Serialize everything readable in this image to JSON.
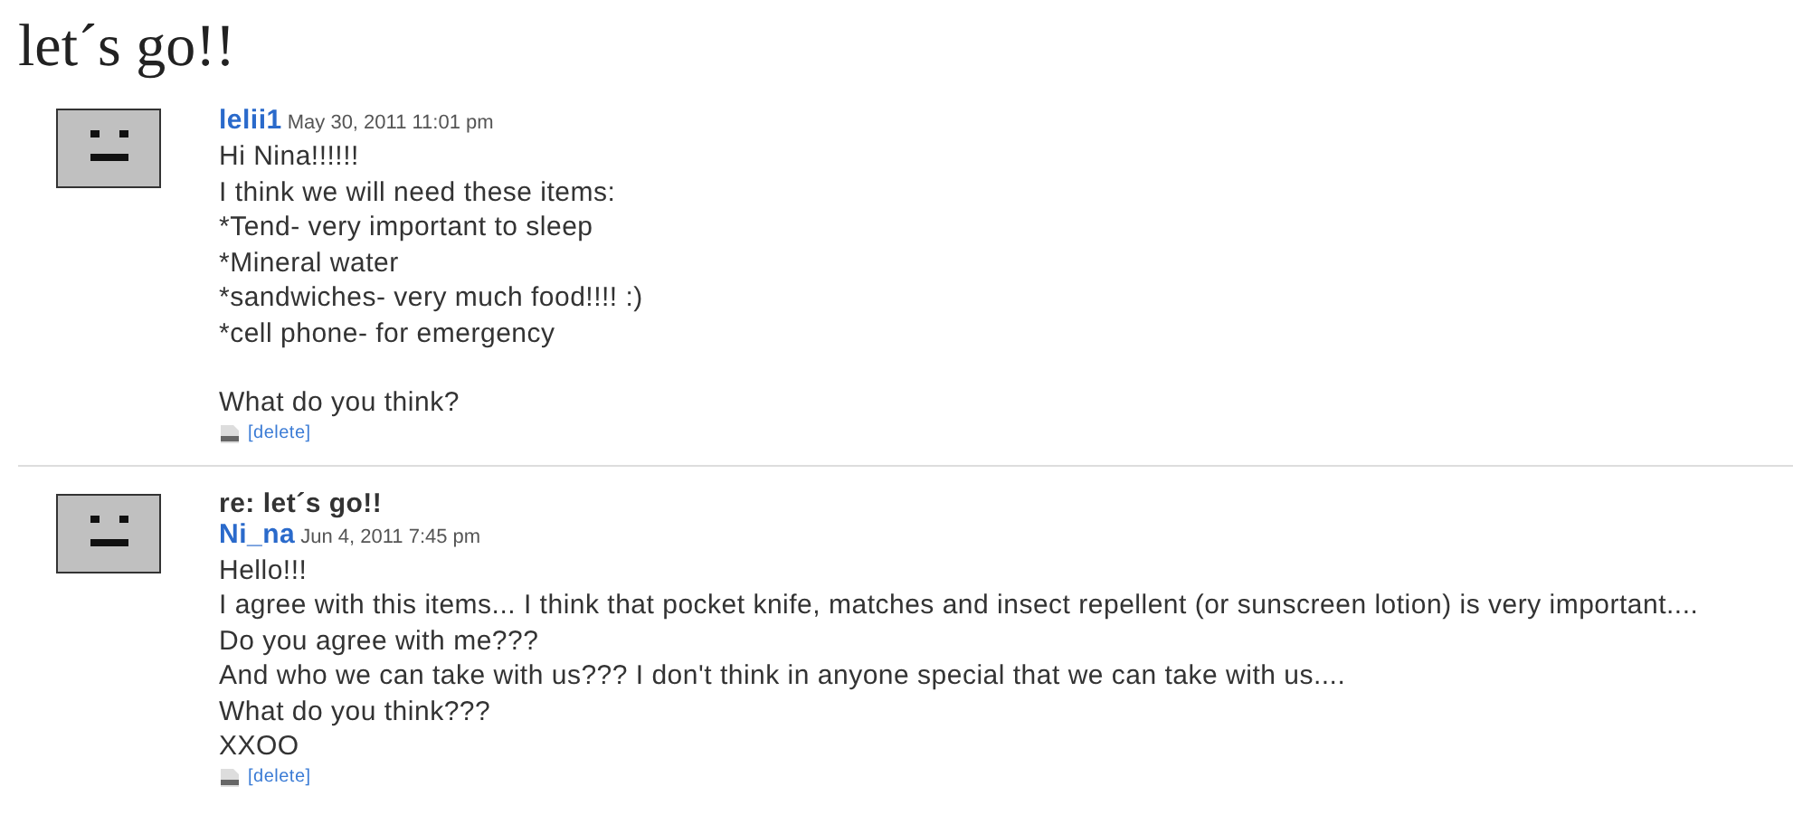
{
  "title": "let´s go!!",
  "posts": [
    {
      "author": "lelii1",
      "date": "May 30, 2011 11:01 pm",
      "paragraphs": [
        [
          "Hi Nina!!!!!!",
          "I think we will need these items:",
          "*Tend- very important to sleep",
          "*Mineral water",
          "*sandwiches- very much food!!!! :)",
          "*cell phone- for emergency"
        ],
        [
          "What do you think?"
        ]
      ],
      "delete": "[delete]"
    },
    {
      "subject": "re: let´s go!!",
      "author": "Ni_na",
      "date": "Jun 4, 2011 7:45 pm",
      "paragraphs": [
        [
          "Hello!!!",
          "I agree with this items... I think that pocket knife, matches and insect repellent (or sunscreen lotion) is very important....",
          "Do you agree with me???",
          "And who we can take with us??? I don't think in anyone special that we can take with us....",
          "What do you think???",
          "XXOO"
        ]
      ],
      "delete": "[delete]"
    }
  ]
}
